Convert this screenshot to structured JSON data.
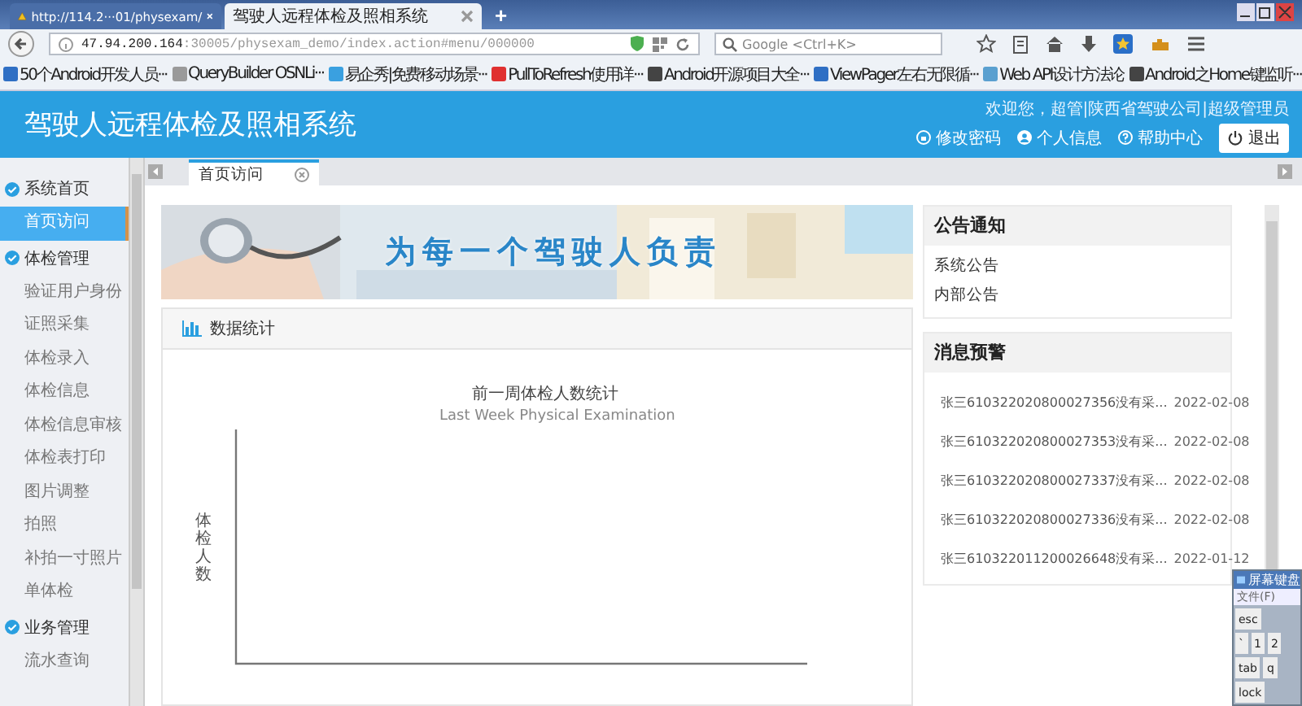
{
  "browser": {
    "tabs": [
      {
        "title": "http://114.2···01/physexam/",
        "kind": "warning",
        "selected": false
      },
      {
        "title": "驾驶人远程体检及照相系统",
        "kind": "page",
        "selected": true
      }
    ],
    "new_tab": "+",
    "address_host": "47.94.200.164",
    "address_path": ":30005/physexam_demo/index.action#menu/000000",
    "search_placeholder": "Google <Ctrl+K>",
    "bookmarks": [
      {
        "label": "50个Android开发人员···",
        "color": "#2f6fc4"
      },
      {
        "label": "QueryBuilder OSNLi···",
        "color": "#9a9a9a"
      },
      {
        "label": "易企秀|免费移动场景···",
        "color": "#3aa0e0"
      },
      {
        "label": "PullToRefresh使用详···",
        "color": "#e03030"
      },
      {
        "label": "Android开源项目大全···",
        "color": "#444444"
      },
      {
        "label": "ViewPager左右无限循···",
        "color": "#2f6fc4"
      },
      {
        "label": "Web API设计方法论",
        "color": "#5aa0d0"
      },
      {
        "label": "Android之Home键监听···",
        "color": "#444444"
      }
    ]
  },
  "header": {
    "title": "驾驶人远程体检及照相系统",
    "welcome": "欢迎您，超管|陕西省驾驶公司|超级管理员",
    "links": [
      {
        "label": "修改密码",
        "kind": "key"
      },
      {
        "label": "个人信息",
        "kind": "user"
      },
      {
        "label": "帮助中心",
        "kind": "help"
      }
    ],
    "logout": "退出"
  },
  "sidebar": {
    "groups": [
      {
        "label": "系统首页",
        "items": [
          {
            "label": "首页访问",
            "selected": true
          }
        ]
      },
      {
        "label": "体检管理",
        "items": [
          {
            "label": "验证用户身份",
            "selected": false
          },
          {
            "label": "证照采集",
            "selected": false
          },
          {
            "label": "体检录入",
            "selected": false
          },
          {
            "label": "体检信息",
            "selected": false
          },
          {
            "label": "体检信息审核",
            "selected": false
          },
          {
            "label": "体检表打印",
            "selected": false
          },
          {
            "label": "图片调整",
            "selected": false
          },
          {
            "label": "拍照",
            "selected": false
          },
          {
            "label": "补拍一寸照片",
            "selected": false
          },
          {
            "label": "单体检",
            "selected": false
          }
        ]
      },
      {
        "label": "业务管理",
        "items": [
          {
            "label": "流水查询",
            "selected": false
          }
        ]
      }
    ]
  },
  "tabs": [
    {
      "label": "首页访问",
      "selected": true
    }
  ],
  "banner": {
    "slogan": "为每一个驾驶人负责"
  },
  "stats": {
    "title": "数据统计",
    "chart_title": "前一周体检人数统计",
    "chart_subtitle": "Last Week Physical Examination",
    "ylabel": "体检人数"
  },
  "notices": {
    "title": "公告通知",
    "items": [
      "系统公告",
      "内部公告"
    ]
  },
  "alerts": {
    "title": "消息预警",
    "items": [
      {
        "text": "张三610322020800027356没有采...",
        "date": "2022-02-08"
      },
      {
        "text": "张三610322020800027353没有采...",
        "date": "2022-02-08"
      },
      {
        "text": "张三610322020800027337没有采...",
        "date": "2022-02-08"
      },
      {
        "text": "张三610322020800027336没有采...",
        "date": "2022-02-08"
      },
      {
        "text": "张三610322011200026648没有采...",
        "date": "2022-01-12"
      }
    ]
  },
  "keyboard": {
    "title": "屏幕键盘",
    "menu": "文件(F)",
    "rows": [
      [
        "esc"
      ],
      [
        "`",
        "1",
        "2"
      ],
      [
        "tab",
        "q"
      ],
      [
        "lock"
      ]
    ]
  }
}
